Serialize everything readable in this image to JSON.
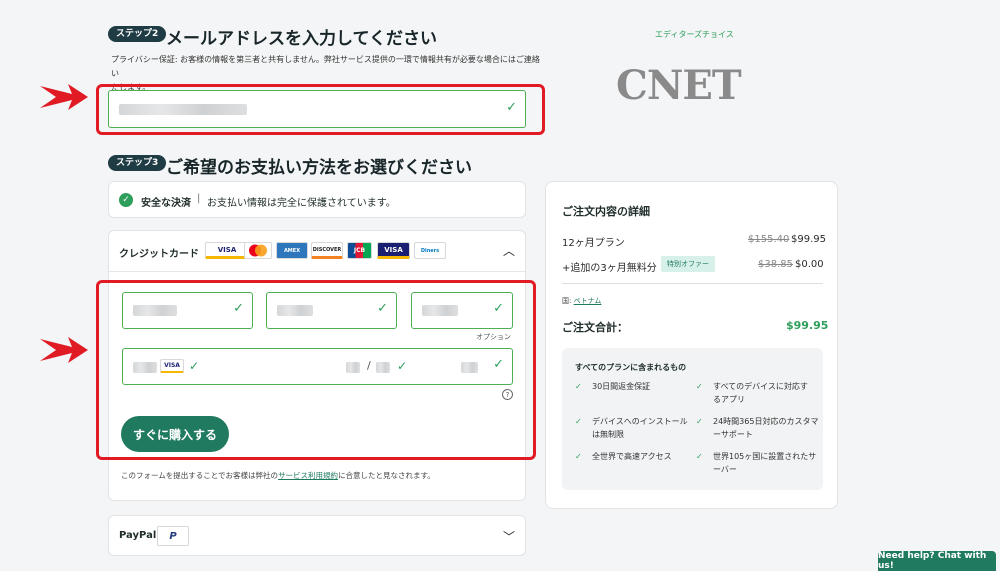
{
  "step2": {
    "badge": "ステップ2",
    "title": "メールアドレスを入力してください",
    "privacy_line1": "プライバシー保証: お客様の情報を第三者と共有しません。弊社サービス提供の一環で情報共有が必要な場合にはご連絡い",
    "privacy_line2": "たします。"
  },
  "editors_choice": "エディターズチョイス",
  "brand": "CNET",
  "step3": {
    "badge": "ステップ3",
    "title": "ご希望のお支払い方法をお選びください"
  },
  "secure": {
    "label": "安全な決済",
    "sep": "|",
    "text": "お支払い情報は完全に保護されています。"
  },
  "credit": {
    "label": "クレジットカード",
    "logos": [
      "VISA",
      "MC",
      "AMEX",
      "DISCOVER",
      "JCB",
      "VISA",
      "Diners"
    ],
    "optional": "オプション",
    "slash": "/",
    "help": "?",
    "button": "すぐに購入する",
    "terms_pre": "このフォームを提出することでお客様は弊社の",
    "terms_link": "サービス利用規約",
    "terms_post": "に合意したと見なされます。"
  },
  "paypal": {
    "label": "PayPal",
    "logo": "P"
  },
  "summary": {
    "title": "ご注文内容の詳細",
    "plan_label": "12ヶ月プラン",
    "plan_old": "$155.40",
    "plan_price": "$99.95",
    "bonus_label": "+追加の3ヶ月無料分",
    "bonus_badge": "特別オファー",
    "bonus_old": "$38.85",
    "bonus_price": "$0.00",
    "country_prefix": "国:",
    "country": "ベトナム",
    "total_label": "ご注文合計：",
    "total": "$99.95",
    "features_title": "すべてのプランに含まれるもの",
    "features": [
      [
        "30日間返金保証"
      ],
      [
        "すべてのデバイスに対応す",
        "るアプリ"
      ],
      [
        "デバイスへのインストール",
        "は無制限"
      ],
      [
        "24時間365日対応のカスタマ",
        "ーサポート"
      ],
      [
        "全世界で高速アクセス"
      ],
      [
        "世界105ヶ国に設置されたサ",
        "ーバー"
      ]
    ]
  },
  "chat": "Need help? Chat with us!",
  "colors": {
    "accent": "#1f7a5f",
    "check": "#2e9e5b",
    "highlight": "#e01b24"
  }
}
